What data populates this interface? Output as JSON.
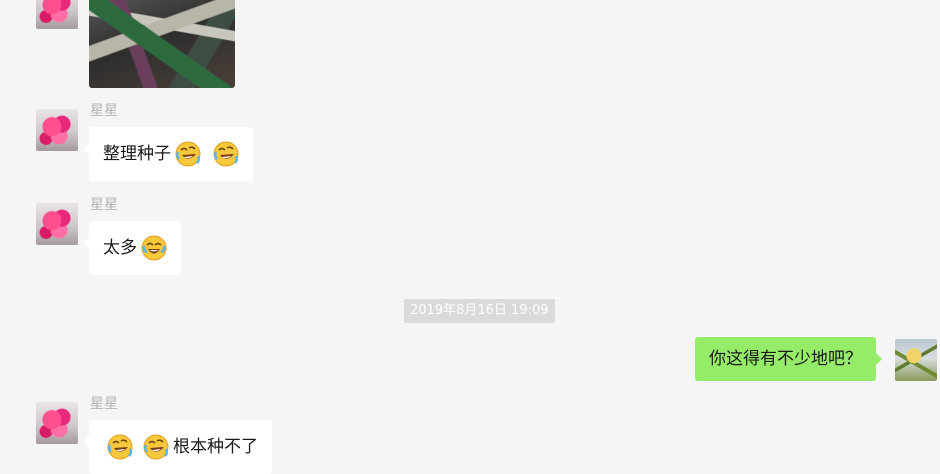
{
  "messages": [
    {
      "sender": "",
      "avatar": "flower-avatar",
      "type": "image",
      "image": "seed-packets-photo"
    },
    {
      "sender": "星星",
      "avatar": "flower-avatar",
      "type": "text",
      "text": "整理种子",
      "emojis": [
        "rolling-laughing-emoji",
        "rolling-laughing-emoji"
      ]
    },
    {
      "sender": "星星",
      "avatar": "flower-avatar",
      "type": "text",
      "text": "太多",
      "emojis": [
        "tears-of-joy-emoji"
      ]
    },
    {
      "type": "timestamp",
      "text": "2019年8月16日 19:09"
    },
    {
      "sender": "self",
      "avatar": "plant-avatar",
      "type": "text",
      "text": "你这得有不少地吧？"
    },
    {
      "sender": "星星",
      "avatar": "flower-avatar",
      "type": "text",
      "text": "根本种不了",
      "emojis": [
        "rolling-laughing-emoji",
        "rolling-laughing-emoji"
      ]
    }
  ],
  "colors": {
    "background": "#f5f5f5",
    "incoming_bubble": "#ffffff",
    "outgoing_bubble": "#95ec69",
    "sender_name": "#b2b2b2",
    "timestamp_badge": "#dadada"
  }
}
